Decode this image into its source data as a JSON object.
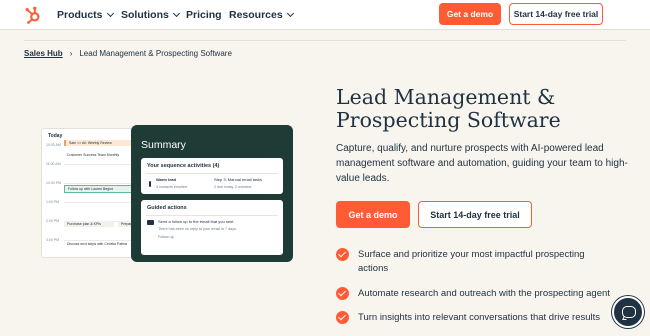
{
  "nav": {
    "items": [
      {
        "label": "Products"
      },
      {
        "label": "Solutions"
      },
      {
        "label": "Pricing"
      },
      {
        "label": "Resources"
      }
    ],
    "demo_label": "Get a demo",
    "trial_label": "Start 14-day free trial"
  },
  "breadcrumb": {
    "parent": "Sales Hub",
    "current": "Lead Management & Prospecting Software"
  },
  "hero": {
    "title_line1": "Lead Management &",
    "title_line2": "Prospecting Software",
    "subtitle": "Capture, qualify, and nurture prospects with AI-powered lead management software and automation, guiding your team to high-value leads.",
    "demo_label": "Get a demo",
    "trial_label": "Start 14-day free trial",
    "features": [
      "Surface and prioritize your most impactful prospecting actions",
      "Automate research and outreach with the prospecting agent",
      "Turn insights into relevant conversations that drive results"
    ]
  },
  "calendar": {
    "title": "Today",
    "times": [
      "10:00 AM",
      "11:00 AM",
      "12:00 PM",
      "1:00 PM",
      "2:00 PM",
      "3:00 PM"
    ],
    "events": [
      "Sam <> Ali: Weekly Review",
      "Customer Success Team Monthly",
      "Follow up with Lauren Begint",
      "Purchase plan & KPIs",
      "Prepare",
      "Discuss next steps with Cecelia Patina"
    ]
  },
  "summary": {
    "title": "Summary",
    "sequence_title": "Your sequence activities (4)",
    "warm_label": "Warm lead",
    "warm_sub": "3 contacts enrolled",
    "step_label": "Step 3: Manual email tasks",
    "step_sub": "2 due today, 2 overdue",
    "guided_title": "Guided actions",
    "guided_main": "Send a follow up to the email that you sent",
    "guided_sub": "There has been no reply to your email in 7 days.",
    "guided_link": "Follow up"
  },
  "colors": {
    "accent": "#ff5c35",
    "navy": "#213343",
    "panel": "#1e3b35",
    "page_bg": "#f8f5ee"
  },
  "icons": {
    "logo": "hubspot-sprocket-icon",
    "chat": "chat-bubble-icon",
    "check": "check-circle-icon"
  }
}
